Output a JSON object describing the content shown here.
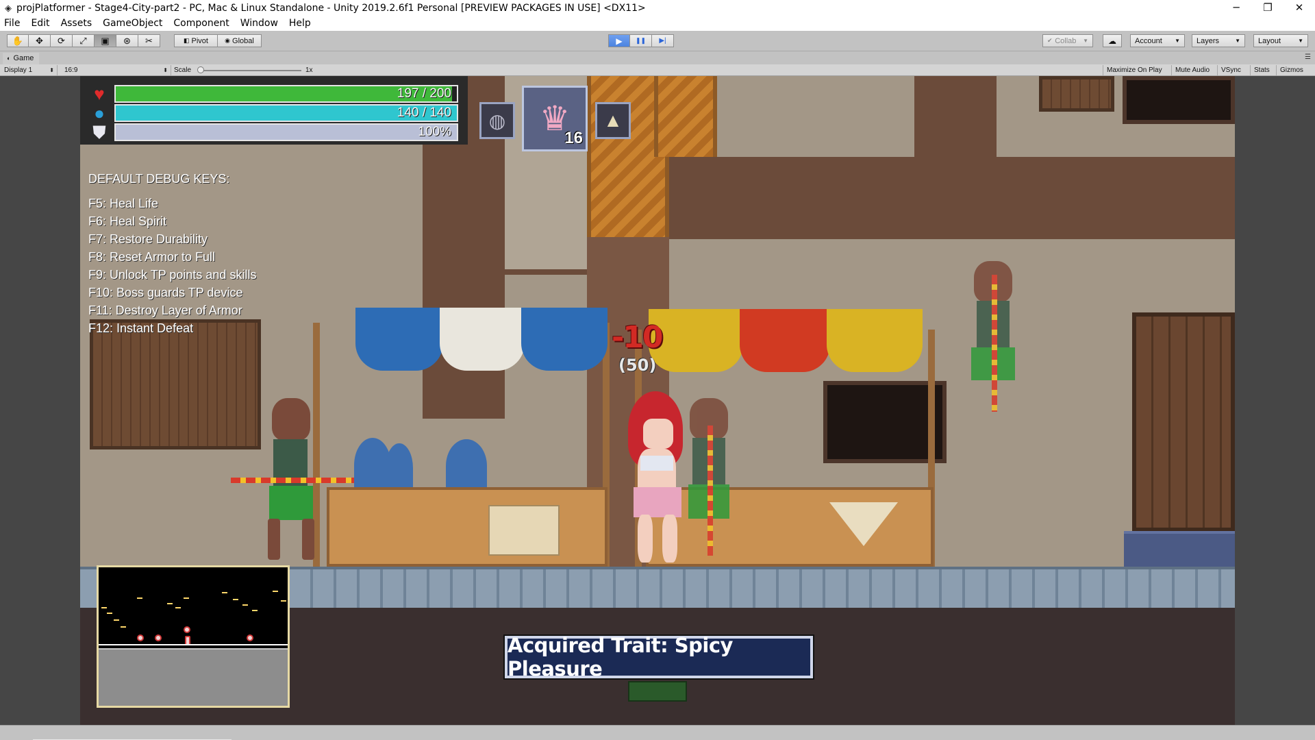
{
  "window": {
    "title": "projPlatformer - Stage4-City-part2 - PC, Mac & Linux Standalone - Unity 2019.2.6f1 Personal [PREVIEW PACKAGES IN USE] <DX11>",
    "minimize": "─",
    "maximize": "❐",
    "close": "✕"
  },
  "menu": [
    "File",
    "Edit",
    "Assets",
    "GameObject",
    "Component",
    "Window",
    "Help"
  ],
  "toolbar": {
    "tools": [
      "hand-icon",
      "move-icon",
      "rotate-icon",
      "scale-icon",
      "rect-icon",
      "transform-icon",
      "custom-tool-icon"
    ],
    "tool_glyphs": [
      "✋",
      "✥",
      "⟳",
      "⤢",
      "▣",
      "⊛",
      "✂"
    ],
    "pivot_label": "Pivot",
    "global_label": "Global",
    "play_glyph": "▶",
    "pause_glyph": "❚❚",
    "step_glyph": "▶|",
    "collab_label": "Collab",
    "cloud_glyph": "☁",
    "account_label": "Account",
    "layers_label": "Layers",
    "layout_label": "Layout"
  },
  "game_tab": {
    "label": "Game",
    "display": "Display 1",
    "aspect": "16:9",
    "scale_label": "Scale",
    "scale_value": "1x",
    "maximize_on_play": "Maximize On Play",
    "mute_audio": "Mute Audio",
    "vsync": "VSync",
    "stats": "Stats",
    "gizmos": "Gizmos"
  },
  "hud": {
    "health": {
      "text": "197 / 200",
      "fraction": 0.985,
      "color": "#3fb83a"
    },
    "spirit": {
      "text": "140 / 140",
      "fraction": 1.0,
      "color": "#2fc6cf"
    },
    "durability": {
      "text": "100%",
      "fraction": 1.0,
      "color": "#b9bfd6"
    },
    "item_count": "16"
  },
  "debug": {
    "title": "DEFAULT DEBUG KEYS:",
    "lines": [
      "F5: Heal Life",
      "F6: Heal Spirit",
      "F7: Restore Durability",
      "F8: Reset Armor to Full",
      "F9: Unlock TP points and skills",
      "F10: Boss guards TP device",
      "F11: Destroy Layer of Armor",
      "F12: Instant Defeat"
    ]
  },
  "combat": {
    "damage": "-10",
    "sub_damage": "(50)"
  },
  "trait_banner": "Acquired Trait: Spicy Pleasure"
}
